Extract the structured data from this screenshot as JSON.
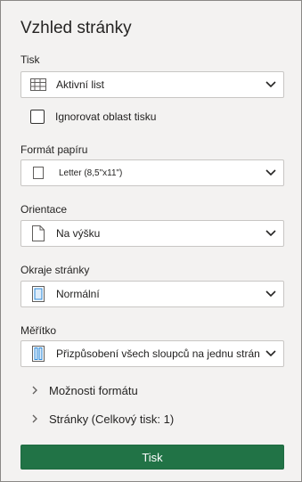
{
  "panel": {
    "title": "Vzhled stránky"
  },
  "print": {
    "label": "Tisk",
    "selected": "Aktivní list",
    "icon": "grid-sheet-icon"
  },
  "ignore_print_area": {
    "label": "Ignorovat oblast tisku",
    "checked": false
  },
  "paper_format": {
    "label": "Formát papíru",
    "selected": "Letter (8,5\"x11\")",
    "icon": "page-outline-icon"
  },
  "orientation": {
    "label": "Orientace",
    "selected": "Na výšku",
    "icon": "portrait-page-icon"
  },
  "margins": {
    "label": "Okraje stránky",
    "selected": "Normální",
    "icon": "margins-page-icon"
  },
  "scaling": {
    "label": "Měřítko",
    "selected": "Přizpůsobení všech sloupců na jednu stránku",
    "icon": "fit-columns-icon"
  },
  "expanders": {
    "format_options": "Možnosti formátu",
    "pages": "Stránky (Celkový tisk: 1)"
  },
  "actions": {
    "print_button": "Tisk"
  },
  "colors": {
    "accent": "#217346",
    "panel_bg": "#f3f2f1",
    "border": "#c8c6c4"
  }
}
